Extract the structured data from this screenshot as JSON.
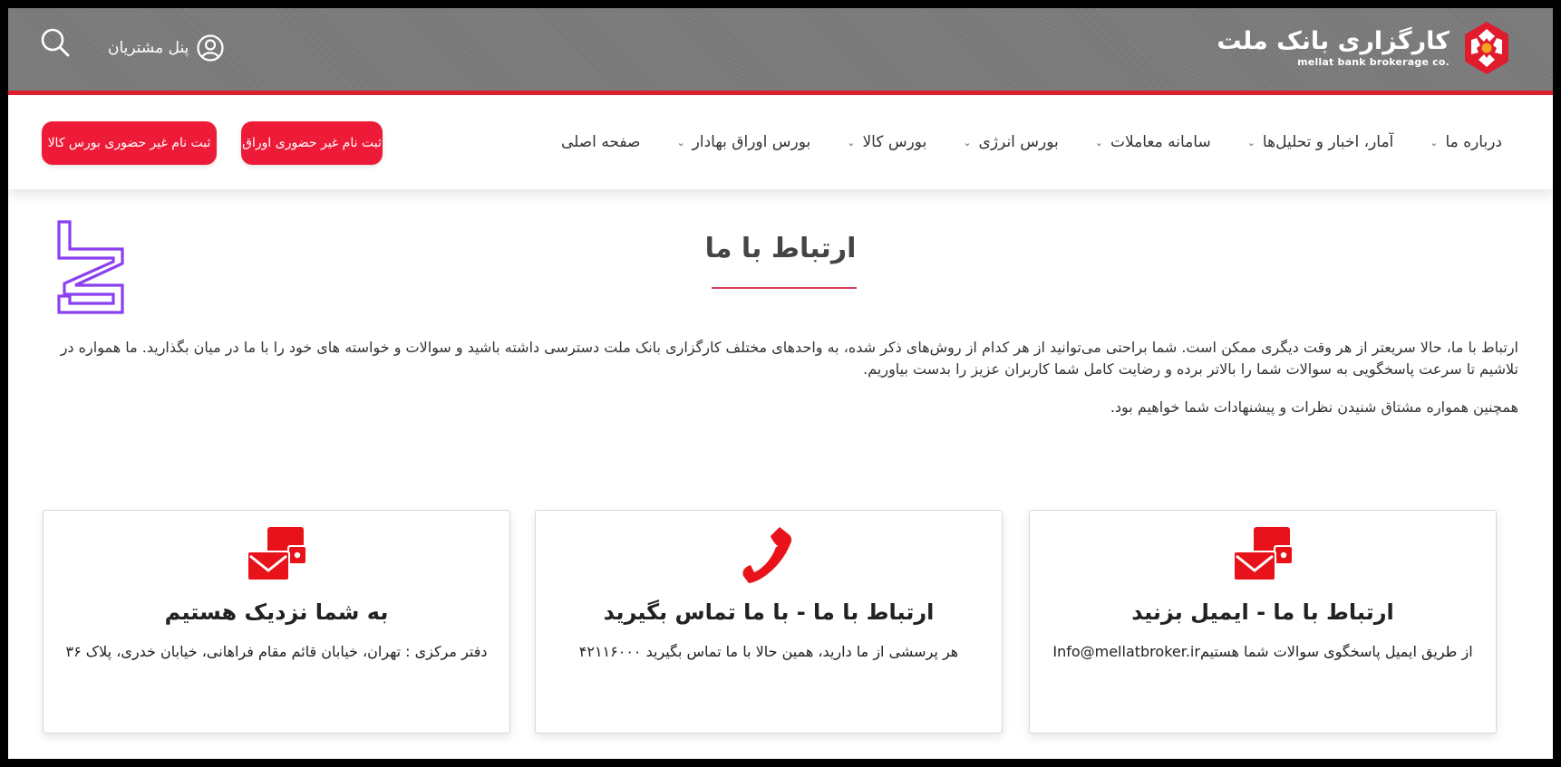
{
  "header": {
    "logo_title": "کارگزاری بانک ملت",
    "logo_subtitle": "mellat bank brokerage co.",
    "customer_panel_label": "پنل مشتریان"
  },
  "nav": {
    "items": [
      {
        "label": "صفحه اصلی",
        "has_dropdown": false
      },
      {
        "label": "بورس اوراق بهادار",
        "has_dropdown": true
      },
      {
        "label": "بورس کالا",
        "has_dropdown": true
      },
      {
        "label": "بورس انرژی",
        "has_dropdown": true
      },
      {
        "label": "سامانه معاملات",
        "has_dropdown": true
      },
      {
        "label": "آمار، اخبار و تحلیل‌ها",
        "has_dropdown": true
      },
      {
        "label": "درباره ما",
        "has_dropdown": true
      }
    ],
    "cta_securities": "ثبت نام غیر حضوری اوراق",
    "cta_commodity": "ثبت نام غیر حضوری بورس کالا"
  },
  "content": {
    "title": "ارتباط با ما",
    "intro_1": "ارتباط با ما، حالا سریعتر از هر وقت دیگری ممکن است. شما براحتی می‌توانید از هر کدام از روش‌های ذکر شده، به واحدهای مختلف کارگزاری بانک ملت دسترسی داشته باشید و سوالات و خواسته های خود را با ما در میان بگذارید. ما همواره در تلاشیم تا سرعت پاسخگویی به سوالات شما را بالاتر برده و رضایت کامل شما کاربران عزیز را بدست بیاوریم.",
    "intro_2": "همچنین همواره مشتاق شنیدن نظرات و پیشنهادات شما خواهیم بود."
  },
  "cards": {
    "email": {
      "title": "ارتباط با ما - ایمیل بزنید",
      "text": "از طریق ایمیل پاسخگوی سوالات شما هستیمInfo@mellatbroker.ir"
    },
    "phone": {
      "title": "ارتباط با ما - با ما تماس بگیرید",
      "text": "هر پرسشی از ما دارید، همین حالا با ما تماس بگیرید ۴۲۱۱۶۰۰۰"
    },
    "address": {
      "title": "به شما نزدیک هستیم",
      "text": "دفتر مرکزی : تهران، خیابان قائم مقام فراهانی، خیابان خدری، پلاک ۳۶"
    }
  },
  "icons": {
    "brand": "mellat-logo-icon",
    "user": "user-circle-icon",
    "search": "search-icon",
    "decor": "decor-logo-icon",
    "envelope": "envelope-icon",
    "phone": "phone-icon"
  },
  "colors": {
    "accent": "#ee1b38",
    "header_bg": "#7d7d7d",
    "decor": "#8a3ff0",
    "title_rule": "#d8405a"
  }
}
